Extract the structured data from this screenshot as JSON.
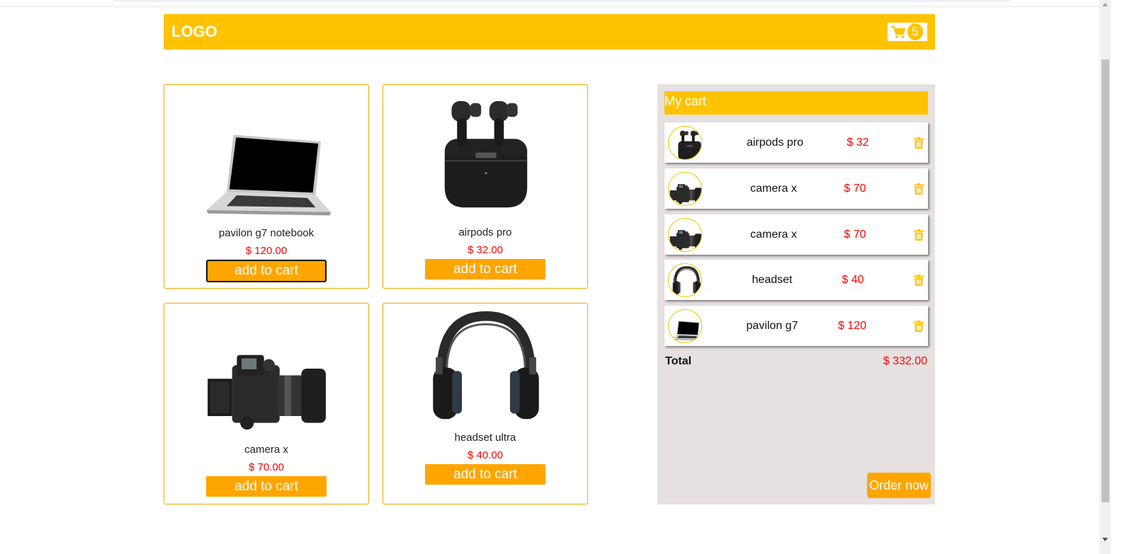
{
  "header": {
    "logo": "LOGO",
    "cart_count": "5"
  },
  "products": [
    {
      "name": "pavilon g7 notebook",
      "price": "$ 120.00",
      "button": "add to cart",
      "icon": "laptop-image"
    },
    {
      "name": "airpods pro",
      "price": "$ 32.00",
      "button": "add to cart",
      "icon": "airpods-image"
    },
    {
      "name": "camera x",
      "price": "$ 70.00",
      "button": "add to cart",
      "icon": "camera-image"
    },
    {
      "name": "headset ultra",
      "price": "$ 40.00",
      "button": "add to cart",
      "icon": "headset-image"
    }
  ],
  "cart": {
    "title": "My cart",
    "items": [
      {
        "name": "airpods pro",
        "price": "$ 32",
        "icon": "airpods-thumb"
      },
      {
        "name": "camera x",
        "price": "$ 70",
        "icon": "camera-thumb"
      },
      {
        "name": "camera x",
        "price": "$ 70",
        "icon": "camera-thumb"
      },
      {
        "name": "headset",
        "price": "$ 40",
        "icon": "headset-thumb"
      },
      {
        "name": "pavilon g7",
        "price": "$ 120",
        "icon": "laptop-thumb"
      }
    ],
    "total_label": "Total",
    "total_value": "$ 332.00",
    "order_button": "Order now"
  },
  "colors": {
    "accent": "#fec300",
    "button": "#ffa500",
    "price": "#ff0000",
    "panel": "#e6e0e0"
  }
}
